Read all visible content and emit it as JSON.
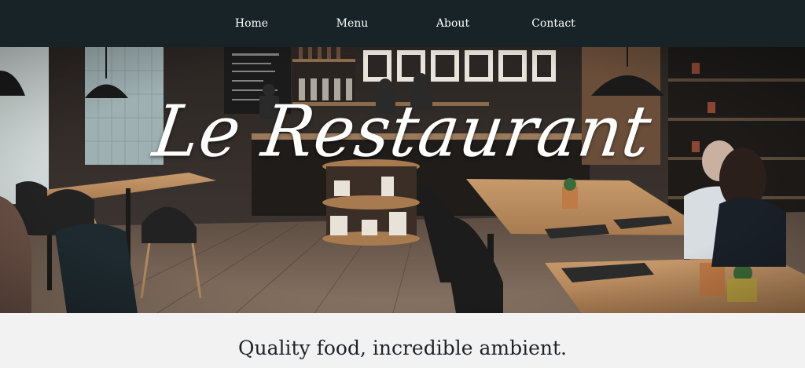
{
  "nav": {
    "items": [
      {
        "label": "Home"
      },
      {
        "label": "Menu"
      },
      {
        "label": "About"
      },
      {
        "label": "Contact"
      }
    ]
  },
  "hero": {
    "title": "Le Restaurant",
    "image": "restaurant-interior-photo"
  },
  "tagline": {
    "text": "Quality food, incredible ambient."
  },
  "colors": {
    "navbar_bg": "#172326",
    "nav_text": "#ffffff",
    "section_bg": "#f2f2f3",
    "tagline_text": "#1f2328"
  }
}
